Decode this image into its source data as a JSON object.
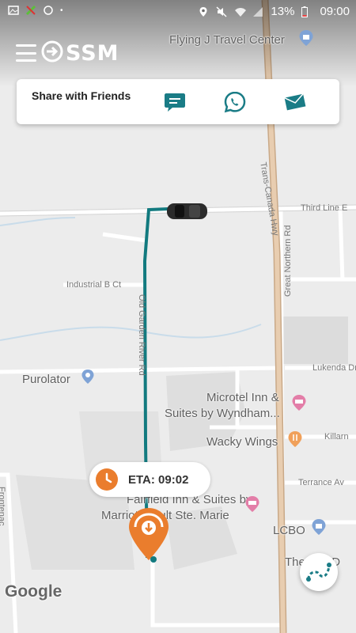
{
  "status_bar": {
    "battery": "13%",
    "time": "09:00",
    "icons": [
      "image-icon",
      "app-notification-icon",
      "sync-icon",
      "location-icon",
      "mute-icon",
      "wifi-icon",
      "signal-icon",
      "battery-icon"
    ]
  },
  "app": {
    "logo_text": "SSM",
    "menu_icon": "hamburger-menu-icon"
  },
  "share": {
    "title": "Share with Friends",
    "buttons": [
      {
        "name": "sms-share-button",
        "icon": "chat-bubble-icon"
      },
      {
        "name": "whatsapp-share-button",
        "icon": "whatsapp-icon"
      },
      {
        "name": "email-share-button",
        "icon": "envelope-icon"
      }
    ]
  },
  "map": {
    "places": {
      "flying_j": "Flying J Travel Center",
      "purolator": "Purolator",
      "microtel_1": "Microtel Inn &",
      "microtel_2": "Suites by Wyndham...",
      "wacky_wings": "Wacky Wings",
      "fairfield_1": "Fairfield Inn & Suites by",
      "fairfield_2": "Marriott Sault Ste. Marie",
      "lcbo": "LCBO",
      "the_lee": "The Lee D"
    },
    "roads": {
      "trans_canada": "Trans-Canada Hwy",
      "third_line": "Third Line E",
      "industrial": "Industrial B Ct",
      "great_northern": "Great Northern Rd",
      "lukenda": "Lukenda Dr",
      "killarney": "Killarn",
      "terrance": "Terrance Av",
      "old_garden": "Old Garden River Rd",
      "left_rd": "Frontenac"
    }
  },
  "eta": {
    "label": "ETA: 09:02"
  },
  "attribution": "Google",
  "colors": {
    "route": "#127a7f",
    "accent": "#ea7d2d",
    "teal": "#1a7c86",
    "highway": "#dcbf9f",
    "poi_blue": "#7fa3d6",
    "poi_pink": "#e37ea8",
    "poi_orange": "#f0a05a"
  }
}
